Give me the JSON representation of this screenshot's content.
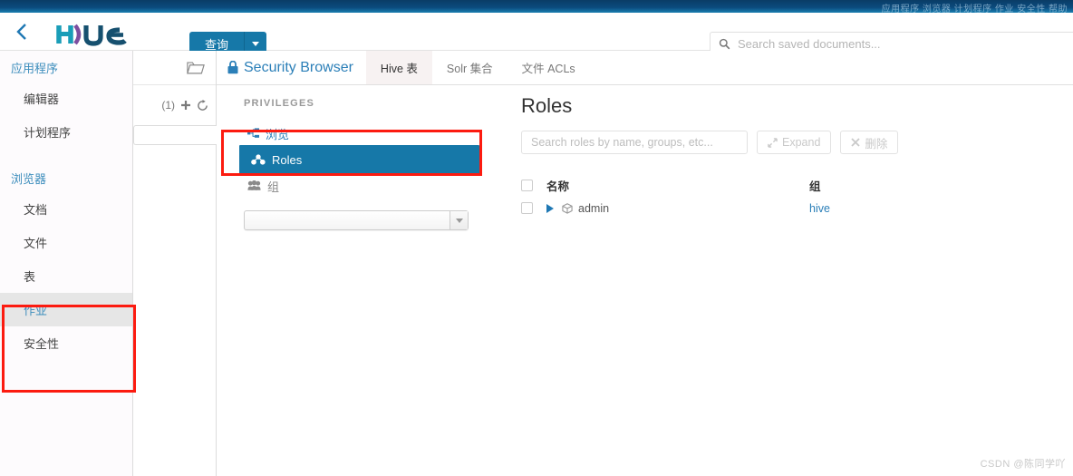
{
  "topbar": {
    "cut_text": "应用程序 浏览器 计划程序 作业 安全性 帮助"
  },
  "header": {
    "back_icon": "chevron-left-icon",
    "logo": "HUE",
    "query_button": {
      "label": "查询",
      "caret": "chevron-down-icon"
    },
    "saved_search": {
      "icon": "search-icon",
      "placeholder": "Search saved documents...",
      "value": ""
    }
  },
  "sidebar": {
    "groups": [
      {
        "label": "应用程序",
        "items": [
          {
            "label": "编辑器",
            "active": false
          },
          {
            "label": "计划程序",
            "active": false
          }
        ]
      },
      {
        "label": "浏览器",
        "items": [
          {
            "label": "文档",
            "active": false
          },
          {
            "label": "文件",
            "active": false
          },
          {
            "label": "表",
            "active": false
          },
          {
            "label": "作业",
            "active": true
          },
          {
            "label": "安全性",
            "active": false
          }
        ]
      }
    ]
  },
  "doc_column": {
    "folder_icon": "folder-icon",
    "count": "(1)",
    "add_icon": "plus-icon",
    "refresh_icon": "refresh-icon",
    "filter_value": ""
  },
  "tabs": {
    "brand": {
      "icon": "lock-icon",
      "label": "Security Browser"
    },
    "items": [
      {
        "label": "Hive 表",
        "active": true
      },
      {
        "label": "Solr 集合",
        "active": false
      },
      {
        "label": "文件 ACLs",
        "active": false
      }
    ]
  },
  "privileges": {
    "title": "PRIVILEGES",
    "links": [
      {
        "label": "浏览",
        "icon": "sitemap-icon",
        "selected": false,
        "style": "link"
      },
      {
        "label": "Roles",
        "icon": "roles-icon",
        "selected": true,
        "style": "link"
      },
      {
        "label": "组",
        "icon": "group-icon",
        "selected": false,
        "style": "gray"
      }
    ],
    "select": {
      "value": "",
      "caret": "chevron-down-icon"
    }
  },
  "roles": {
    "title": "Roles",
    "search_placeholder": "Search roles by name, groups, etc...",
    "search_value": "",
    "expand_button": {
      "label": "Expand",
      "icon": "expand-icon",
      "disabled": true
    },
    "delete_button": {
      "label": "删除",
      "icon": "times-icon",
      "disabled": true
    },
    "columns": {
      "name": "名称",
      "group": "组"
    },
    "rows": [
      {
        "name": "admin",
        "group": "hive",
        "icon": "cube-icon",
        "expander": "triangle-right-icon",
        "checked": false
      }
    ]
  },
  "annotations": {
    "color": "#fc1b10",
    "boxes": [
      {
        "name": "sidebar-security-highlight"
      },
      {
        "name": "roles-item-highlight"
      }
    ]
  },
  "watermark": "CSDN @陈同学吖"
}
